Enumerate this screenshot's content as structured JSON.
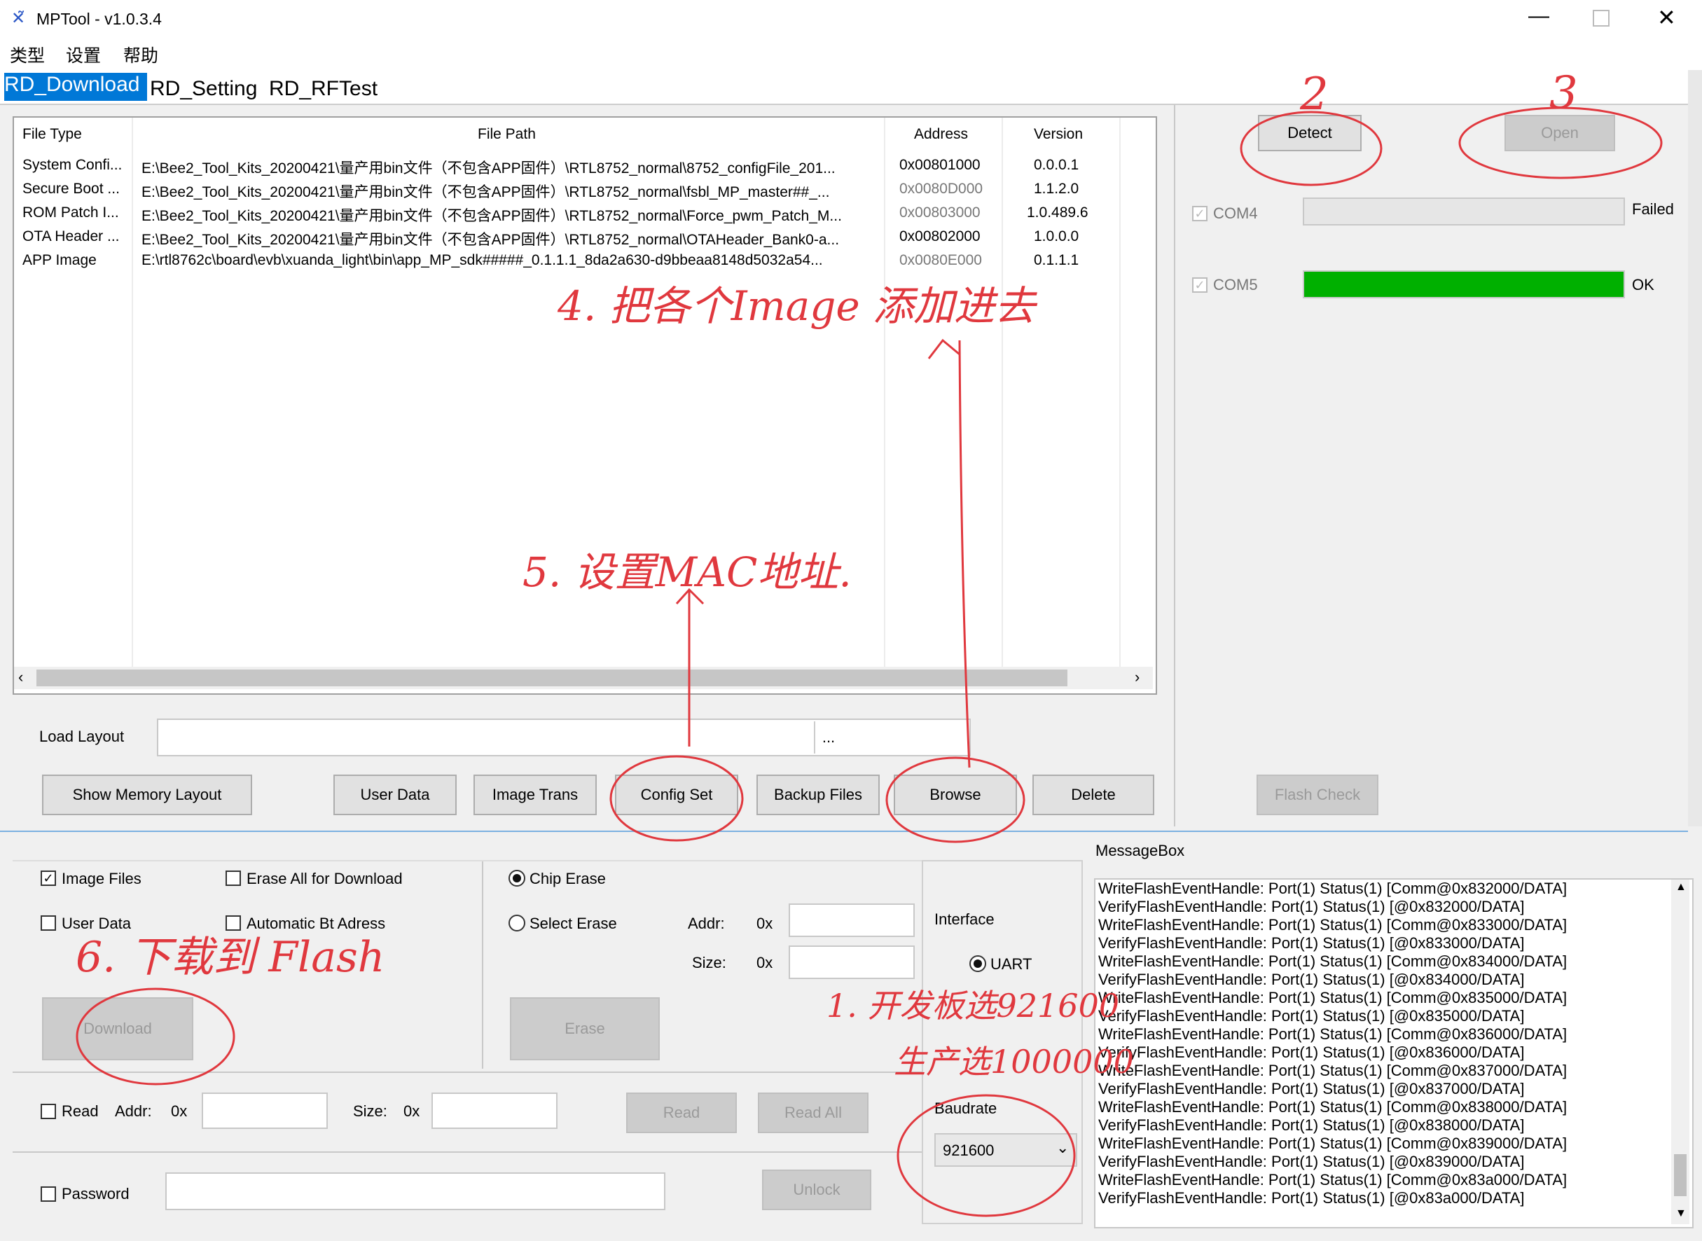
{
  "window": {
    "title": "MPTool - v1.0.3.4"
  },
  "menu": [
    "类型",
    "设置",
    "帮助"
  ],
  "tabs": [
    "RD_Download",
    "RD_Setting",
    "RD_RFTest"
  ],
  "file_table": {
    "headers": [
      "File Type",
      "File Path",
      "Address",
      "Version"
    ],
    "rows": [
      {
        "type": "System Confi...",
        "path": "E:\\Bee2_Tool_Kits_20200421\\量产用bin文件（不包含APP固件）\\RTL8752_normal\\8752_configFile_201...",
        "address": "0x00801000",
        "version": "0.0.0.1"
      },
      {
        "type": "Secure Boot ...",
        "path": "E:\\Bee2_Tool_Kits_20200421\\量产用bin文件（不包含APP固件）\\RTL8752_normal\\fsbl_MP_master##_...",
        "address": "0x0080D000",
        "version": "1.1.2.0"
      },
      {
        "type": "ROM Patch I...",
        "path": "E:\\Bee2_Tool_Kits_20200421\\量产用bin文件（不包含APP固件）\\RTL8752_normal\\Force_pwm_Patch_M...",
        "address": "0x00803000",
        "version": "1.0.489.6"
      },
      {
        "type": "OTA Header ...",
        "path": "E:\\Bee2_Tool_Kits_20200421\\量产用bin文件（不包含APP固件）\\RTL8752_normal\\OTAHeader_Bank0-a...",
        "address": "0x00802000",
        "version": "1.0.0.0"
      },
      {
        "type": "APP Image",
        "path": "E:\\rtl8762c\\board\\evb\\xuanda_light\\bin\\app_MP_sdk#####_0.1.1.1_8da2a630-d9bbeaa8148d5032a54...",
        "address": "0x0080E000",
        "version": "0.1.1.1"
      }
    ]
  },
  "load_layout": {
    "label": "Load Layout",
    "browse": "..."
  },
  "buttons": {
    "show_memory": "Show Memory Layout",
    "user_data": "User Data",
    "image_trans": "Image Trans",
    "config_set": "Config Set",
    "backup_files": "Backup Files",
    "browse": "Browse",
    "delete": "Delete",
    "detect": "Detect",
    "open": "Open",
    "flash_check": "Flash Check",
    "download": "Download",
    "erase": "Erase",
    "read": "Read",
    "read_all": "Read All",
    "unlock": "Unlock"
  },
  "ports": [
    {
      "name": "COM4",
      "status": "Failed",
      "progress": 0
    },
    {
      "name": "COM5",
      "status": "OK",
      "progress": 1.0
    }
  ],
  "options": {
    "image_files": "Image Files",
    "erase_all": "Erase All for Download",
    "user_data": "User Data",
    "auto_bt": "Automatic Bt Adress",
    "chip_erase": "Chip Erase",
    "select_erase": "Select Erase",
    "addr": "Addr:",
    "size": "Size:",
    "hex": "0x",
    "interface": "Interface",
    "uart": "UART",
    "baudrate": "Baudrate",
    "baud_value": "921600",
    "read": "Read",
    "read_addr": "Addr:",
    "read_size": "Size:",
    "password": "Password"
  },
  "messagebox": {
    "title": "MessageBox",
    "lines": [
      "WriteFlashEventHandle: Port(1) Status(1) [Comm@0x832000/DATA]",
      "VerifyFlashEventHandle: Port(1) Status(1) [@0x832000/DATA]",
      "WriteFlashEventHandle: Port(1) Status(1) [Comm@0x833000/DATA]",
      "VerifyFlashEventHandle: Port(1) Status(1) [@0x833000/DATA]",
      "WriteFlashEventHandle: Port(1) Status(1) [Comm@0x834000/DATA]",
      "VerifyFlashEventHandle: Port(1) Status(1) [@0x834000/DATA]",
      "WriteFlashEventHandle: Port(1) Status(1) [Comm@0x835000/DATA]",
      "VerifyFlashEventHandle: Port(1) Status(1) [@0x835000/DATA]",
      "WriteFlashEventHandle: Port(1) Status(1) [Comm@0x836000/DATA]",
      "VerifyFlashEventHandle: Port(1) Status(1) [@0x836000/DATA]",
      "WriteFlashEventHandle: Port(1) Status(1) [Comm@0x837000/DATA]",
      "VerifyFlashEventHandle: Port(1) Status(1) [@0x837000/DATA]",
      "WriteFlashEventHandle: Port(1) Status(1) [Comm@0x838000/DATA]",
      "VerifyFlashEventHandle: Port(1) Status(1) [@0x838000/DATA]",
      "WriteFlashEventHandle: Port(1) Status(1) [Comm@0x839000/DATA]",
      "VerifyFlashEventHandle: Port(1) Status(1) [@0x839000/DATA]",
      "WriteFlashEventHandle: Port(1) Status(1) [Comm@0x83a000/DATA]",
      "VerifyFlashEventHandle: Port(1) Status(1) [@0x83a000/DATA]"
    ]
  },
  "annotations": {
    "n1": "1. 开发板选921600",
    "n1b": "生产选1000000",
    "n2": "2",
    "n3": "3",
    "n4": "4. 把各个Image 添加进去",
    "n5": "5. 设置MAC地址.",
    "n6": "6. 下载到 Flash"
  },
  "colors": {
    "progress_ok": "#00b000",
    "annotation": "#e0383e",
    "tab_active": "#0078d7"
  }
}
